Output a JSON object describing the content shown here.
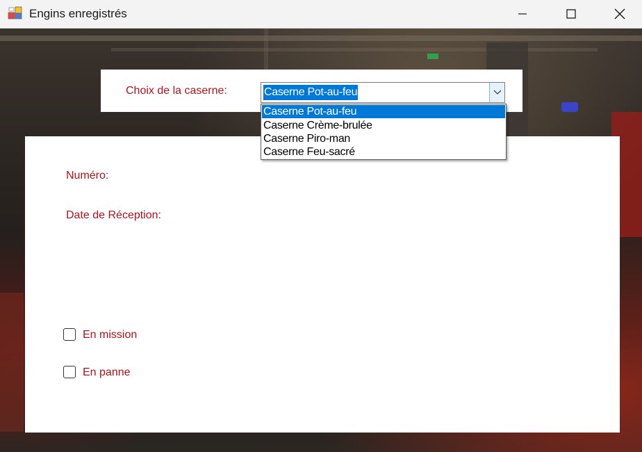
{
  "window": {
    "title": "Engins enregistrés"
  },
  "caserne": {
    "label": "Choix de la caserne:",
    "selected": "Caserne Pot-au-feu",
    "options": [
      "Caserne Pot-au-feu",
      "Caserne Crème-brulée",
      "Caserne Piro-man",
      "Caserne Feu-sacré"
    ]
  },
  "details": {
    "numero_label": "Numéro:",
    "date_label": "Date de Réception:"
  },
  "status": {
    "en_mission_label": "En mission",
    "en_mission_checked": false,
    "en_panne_label": "En panne",
    "en_panne_checked": false
  },
  "colors": {
    "label_red": "#b0121a",
    "selection_blue": "#0078d7"
  }
}
